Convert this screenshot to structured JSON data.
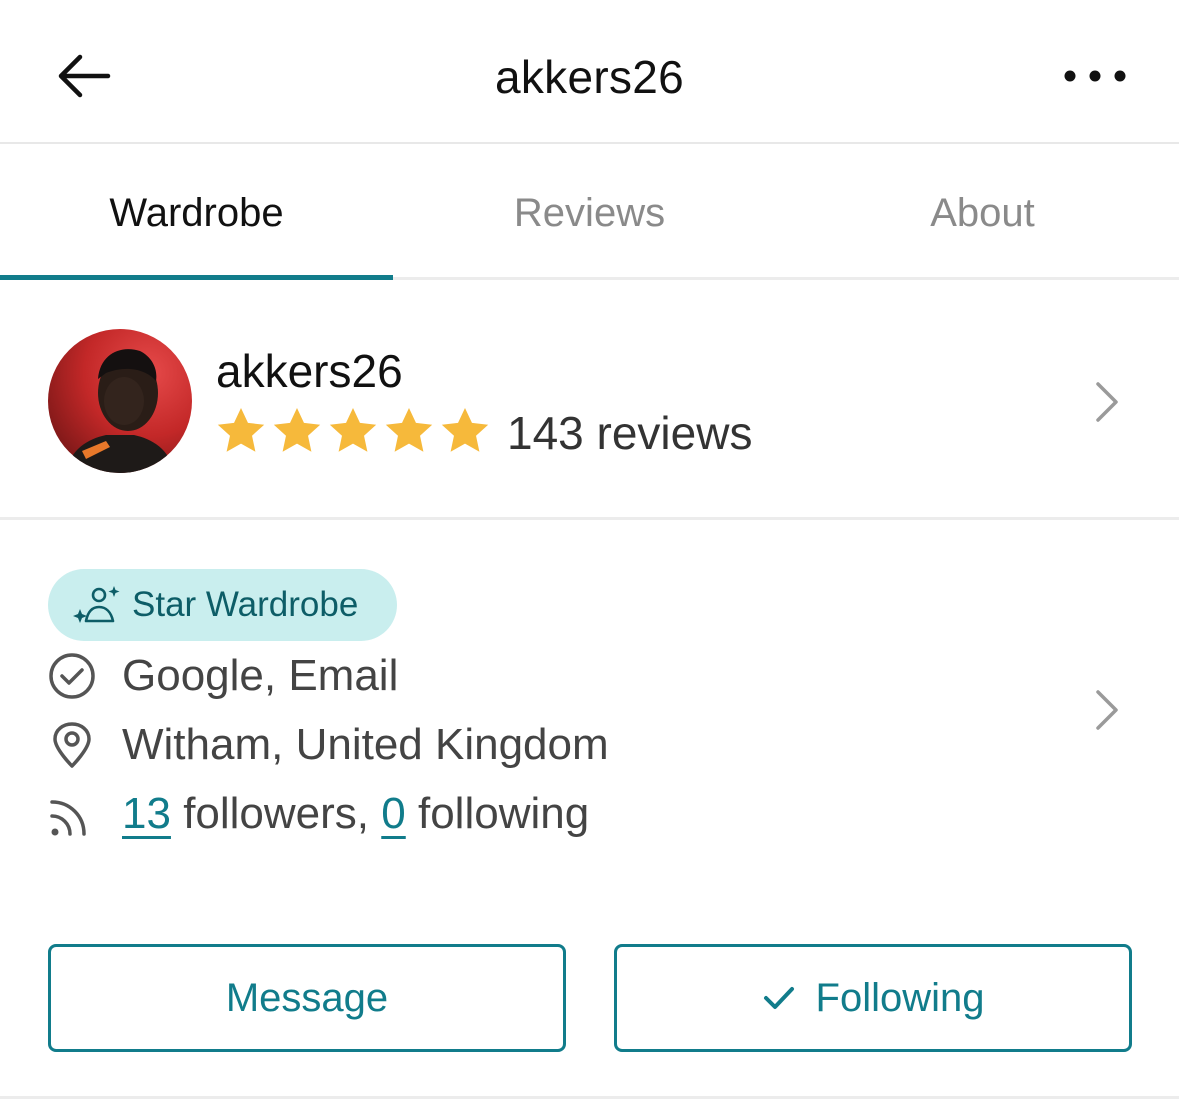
{
  "header": {
    "title": "akkers26",
    "back_icon": "arrow-left-icon",
    "more_icon": "more-horizontal-icon"
  },
  "tabs": [
    {
      "label": "Wardrobe",
      "active": true
    },
    {
      "label": "Reviews",
      "active": false
    },
    {
      "label": "About",
      "active": false
    }
  ],
  "profile": {
    "username": "akkers26",
    "rating": 5,
    "max_rating": 5,
    "reviews_label": "143 reviews"
  },
  "badge": {
    "label": "Star Wardrobe",
    "icon": "sparkle-person-icon"
  },
  "info": {
    "verified_label": "Google, Email",
    "location_label": "Witham, United Kingdom",
    "followers_count": "13",
    "followers_text": "followers,",
    "following_count": "0",
    "following_text": "following"
  },
  "actions": {
    "message_label": "Message",
    "following_label": "Following"
  },
  "colors": {
    "accent": "#117c8b",
    "star": "#f6b93b",
    "badge_bg": "#c9eeee",
    "badge_text": "#0d5d67",
    "divider": "#ececec"
  }
}
